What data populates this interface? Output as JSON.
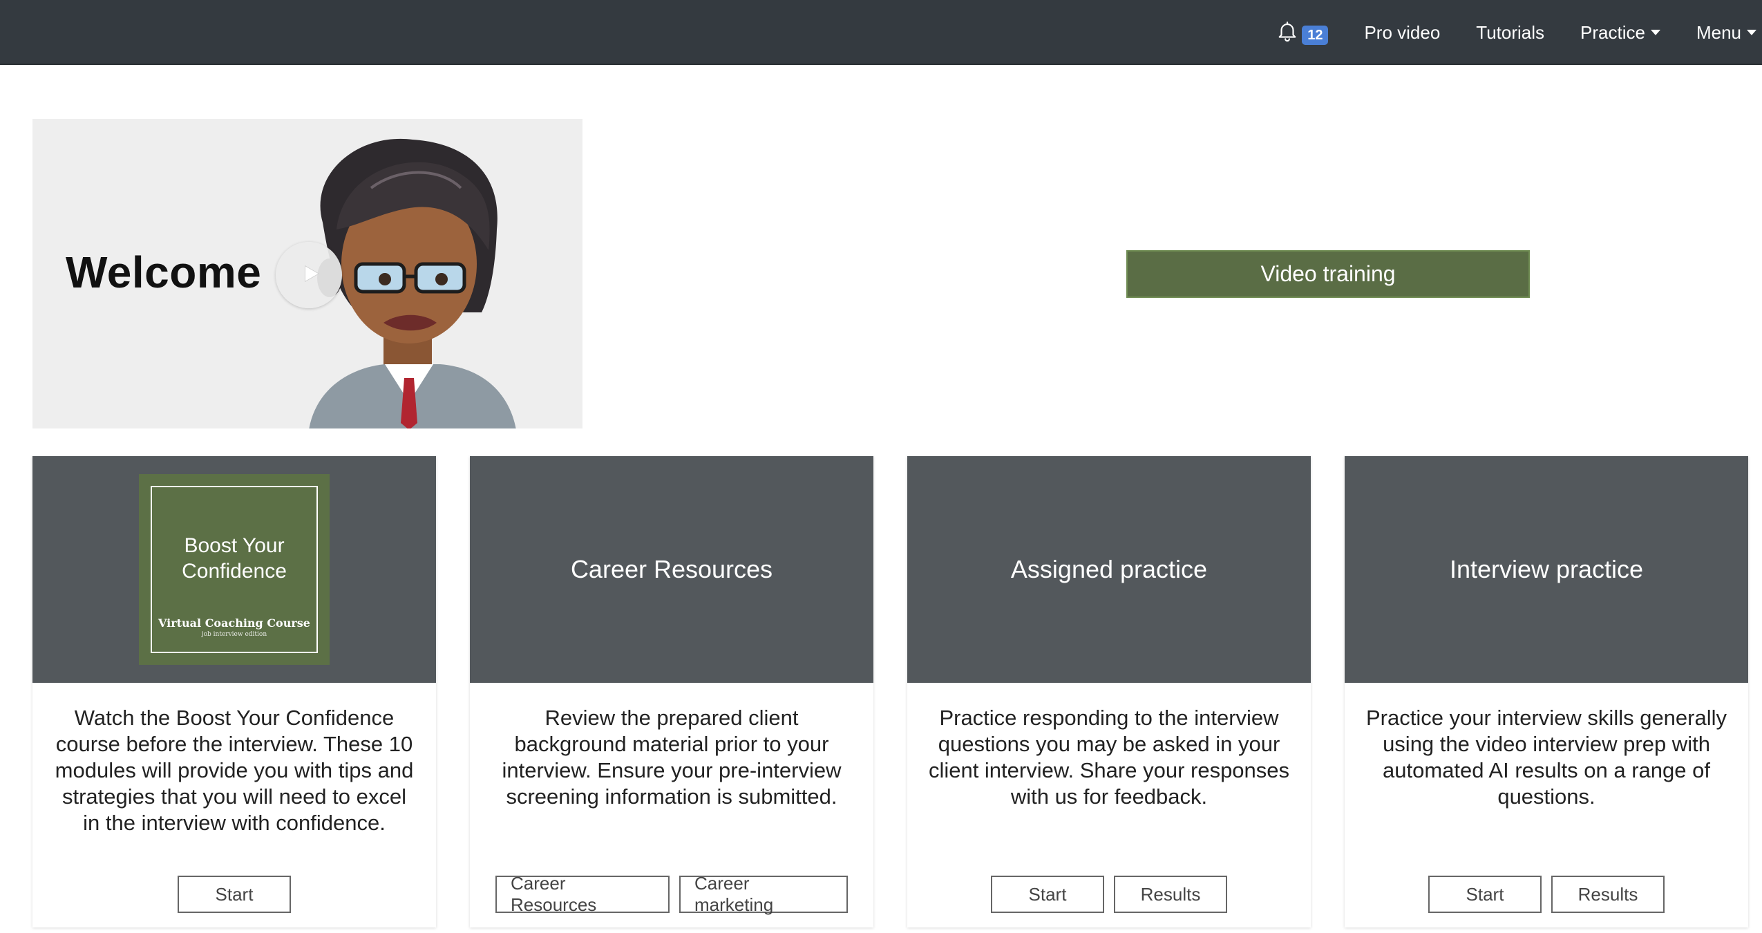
{
  "navbar": {
    "notification_count": "12",
    "links": {
      "pro_video": "Pro video",
      "tutorials": "Tutorials",
      "practice": "Practice",
      "menu": "Menu"
    }
  },
  "hero": {
    "welcome_text": "Welcome",
    "video_training_label": "Video training"
  },
  "cards": {
    "boost": {
      "cover_title": "Boost Your Confidence",
      "cover_subtitle": "Virtual Coaching Course",
      "cover_caption": "job interview edition",
      "description": "Watch the Boost Your Confidence course before the interview. These 10 modules will provide you with tips and strategies that you will need to excel in the interview with confidence.",
      "start_label": "Start"
    },
    "career": {
      "title": "Career Resources",
      "description": "Review the prepared client background material prior to your interview. Ensure your pre-interview screening information is submitted.",
      "resources_label": "Career Resources",
      "marketing_label": "Career marketing"
    },
    "assigned": {
      "title": "Assigned practice",
      "description": "Practice responding to the interview questions you may be asked in your client interview. Share your responses with us for feedback.",
      "start_label": "Start",
      "results_label": "Results"
    },
    "interview": {
      "title": "Interview practice",
      "description": "Practice your interview skills generally using the video interview prep with automated AI results on a range of questions.",
      "start_label": "Start",
      "results_label": "Results"
    }
  },
  "colors": {
    "navbar": "#343a40",
    "badge": "#4a7fd6",
    "card_header": "#53585c",
    "accent_green": "#5a6d45"
  },
  "icons": {
    "notifications": "bell-icon",
    "play": "play-icon",
    "dropdown": "caret-down-icon"
  }
}
